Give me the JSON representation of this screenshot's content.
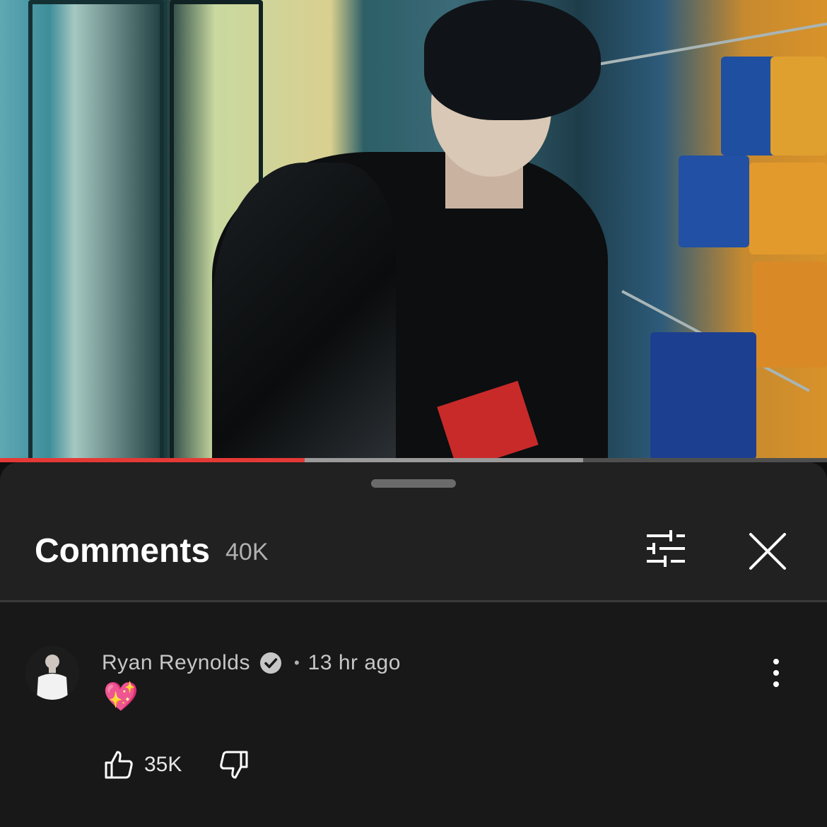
{
  "video": {
    "progress_played": 0.368,
    "progress_buffered": 0.705
  },
  "comments_panel": {
    "title": "Comments",
    "count": "40K",
    "icons": {
      "filter": "sliders-icon",
      "close": "close-icon"
    }
  },
  "comment": {
    "author": "Ryan Reynolds",
    "verified_icon": "verified-check-icon",
    "separator": "•",
    "time": "13 hr ago",
    "text": "💖",
    "likes": "35K",
    "icons": {
      "like": "thumbs-up-icon",
      "dislike": "thumbs-down-icon",
      "more": "more-vertical-icon"
    }
  },
  "colors": {
    "progress_played": "#e53935",
    "sheet_background": "#212121",
    "comment_background": "#181818"
  }
}
